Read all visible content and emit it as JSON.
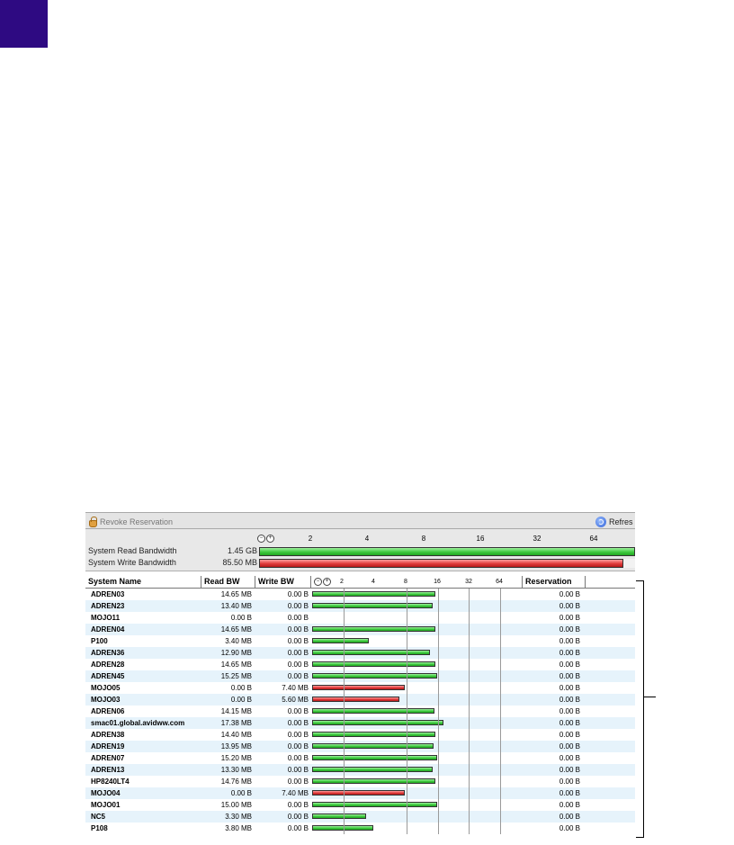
{
  "toolbar": {
    "revoke_label": "Revoke Reservation",
    "refresh_label": "Refres"
  },
  "system": {
    "scale": [
      "2",
      "4",
      "8",
      "16",
      "32",
      "64"
    ],
    "read": {
      "label": "System Read Bandwidth",
      "value": "1.45 GB",
      "fill": 1.0
    },
    "write": {
      "label": "System Write Bandwidth",
      "value": "85.50 MB",
      "fill": 0.97
    }
  },
  "table": {
    "headers": {
      "name": "System Name",
      "read": "Read BW",
      "write": "Write BW",
      "reservation": "Reservation"
    },
    "scale": [
      "2",
      "4",
      "8",
      "16",
      "32",
      "64"
    ],
    "rows": [
      {
        "name": "ADREN03",
        "read": "14.65 MB",
        "write": "0.00 B",
        "res": "0.00 B",
        "bar": "green",
        "level": 0.545
      },
      {
        "name": "ADREN23",
        "read": "13.40 MB",
        "write": "0.00 B",
        "res": "0.00 B",
        "bar": "green",
        "level": 0.53
      },
      {
        "name": "MOJO11",
        "read": "0.00 B",
        "write": "0.00 B",
        "res": "0.00 B",
        "bar": "none",
        "level": 0
      },
      {
        "name": "ADREN04",
        "read": "14.65 MB",
        "write": "0.00 B",
        "res": "0.00 B",
        "bar": "green",
        "level": 0.545
      },
      {
        "name": "P100",
        "read": "3.40 MB",
        "write": "0.00 B",
        "res": "0.00 B",
        "bar": "green",
        "level": 0.25
      },
      {
        "name": "ADREN36",
        "read": "12.90 MB",
        "write": "0.00 B",
        "res": "0.00 B",
        "bar": "green",
        "level": 0.52
      },
      {
        "name": "ADREN28",
        "read": "14.65 MB",
        "write": "0.00 B",
        "res": "0.00 B",
        "bar": "green",
        "level": 0.545
      },
      {
        "name": "ADREN45",
        "read": "15.25 MB",
        "write": "0.00 B",
        "res": "0.00 B",
        "bar": "green",
        "level": 0.55
      },
      {
        "name": "MOJO05",
        "read": "0.00 B",
        "write": "7.40 MB",
        "res": "0.00 B",
        "bar": "red",
        "level": 0.41
      },
      {
        "name": "MOJO03",
        "read": "0.00 B",
        "write": "5.60 MB",
        "res": "0.00 B",
        "bar": "red",
        "level": 0.385
      },
      {
        "name": "ADREN06",
        "read": "14.15 MB",
        "write": "0.00 B",
        "res": "0.00 B",
        "bar": "green",
        "level": 0.54
      },
      {
        "name": "smac01.global.avidww.com",
        "read": "17.38 MB",
        "write": "0.00 B",
        "res": "0.00 B",
        "bar": "green",
        "level": 0.58
      },
      {
        "name": "ADREN38",
        "read": "14.40 MB",
        "write": "0.00 B",
        "res": "0.00 B",
        "bar": "green",
        "level": 0.545
      },
      {
        "name": "ADREN19",
        "read": "13.95 MB",
        "write": "0.00 B",
        "res": "0.00 B",
        "bar": "green",
        "level": 0.535
      },
      {
        "name": "ADREN07",
        "read": "15.20 MB",
        "write": "0.00 B",
        "res": "0.00 B",
        "bar": "green",
        "level": 0.55
      },
      {
        "name": "ADREN13",
        "read": "13.30 MB",
        "write": "0.00 B",
        "res": "0.00 B",
        "bar": "green",
        "level": 0.53
      },
      {
        "name": "HP8240LT4",
        "read": "14.76 MB",
        "write": "0.00 B",
        "res": "0.00 B",
        "bar": "green",
        "level": 0.545
      },
      {
        "name": "MOJO04",
        "read": "0.00 B",
        "write": "7.40 MB",
        "res": "0.00 B",
        "bar": "red",
        "level": 0.41
      },
      {
        "name": "MOJO01",
        "read": "15.00 MB",
        "write": "0.00 B",
        "res": "0.00 B",
        "bar": "green",
        "level": 0.55
      },
      {
        "name": "NC5",
        "read": "3.30 MB",
        "write": "0.00 B",
        "res": "0.00 B",
        "bar": "green",
        "level": 0.24
      },
      {
        "name": "P108",
        "read": "3.80 MB",
        "write": "0.00 B",
        "res": "0.00 B",
        "bar": "green",
        "level": 0.27
      }
    ]
  },
  "colors": {
    "accent_tab": "#2e0a82",
    "read_bar": "#3fc93f",
    "write_bar": "#e03b3b",
    "row_alt": "#e6f3fb"
  }
}
